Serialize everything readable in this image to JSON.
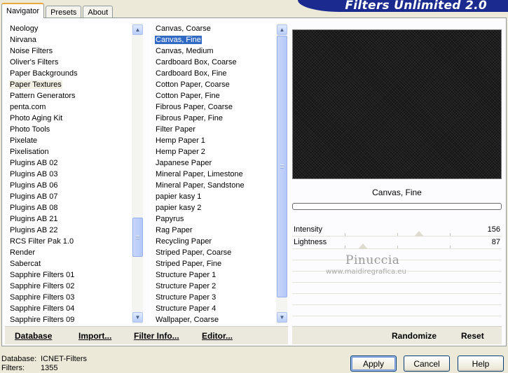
{
  "header": {
    "tabs": [
      {
        "label": "Navigator",
        "active": true
      },
      {
        "label": "Presets",
        "active": false
      },
      {
        "label": "About",
        "active": false
      }
    ],
    "banner_title": "Filters Unlimited 2.0"
  },
  "categories": {
    "items": [
      "Neology",
      "Nirvana",
      "Noise Filters",
      "Oliver's Filters",
      "Paper Backgrounds",
      "Paper Textures",
      "Pattern Generators",
      "penta.com",
      "Photo Aging Kit",
      "Photo Tools",
      "Pixelate",
      "Pixelisation",
      "Plugins AB 02",
      "Plugins AB 03",
      "Plugins AB 06",
      "Plugins AB 07",
      "Plugins AB 08",
      "Plugins AB 21",
      "Plugins AB 22",
      "RCS Filter Pak 1.0",
      "Render",
      "Sabercat",
      "Sapphire Filters 01",
      "Sapphire Filters 02",
      "Sapphire Filters 03",
      "Sapphire Filters 04",
      "Sapphire Filters 09"
    ],
    "selected": "Paper Textures"
  },
  "filters": {
    "items": [
      "Canvas, Coarse",
      "Canvas, Fine",
      "Canvas, Medium",
      "Cardboard Box, Coarse",
      "Cardboard Box, Fine",
      "Cotton Paper, Coarse",
      "Cotton Paper, Fine",
      "Fibrous Paper, Coarse",
      "Fibrous Paper, Fine",
      "Filter Paper",
      "Hemp Paper 1",
      "Hemp Paper 2",
      "Japanese Paper",
      "Mineral Paper, Limestone",
      "Mineral Paper, Sandstone",
      "papier kasy 1",
      "papier kasy 2",
      "Papyrus",
      "Rag Paper",
      "Recycling Paper",
      "Striped Paper, Coarse",
      "Striped Paper, Fine",
      "Structure Paper 1",
      "Structure Paper 2",
      "Structure Paper 3",
      "Structure Paper 4",
      "Wallpaper, Coarse"
    ],
    "selected": "Canvas, Fine"
  },
  "preview": {
    "filter_name": "Canvas, Fine",
    "params": [
      {
        "name": "Intensity",
        "value": "156"
      },
      {
        "name": "Lightness",
        "value": "87"
      }
    ]
  },
  "watermark": {
    "title": "Pinuccia",
    "url": "www.maidiregrafica.eu"
  },
  "toolbar_left": {
    "database": "Database",
    "import": "Import...",
    "filter_info": "Filter Info...",
    "editor": "Editor..."
  },
  "toolbar_right": {
    "randomize": "Randomize",
    "reset": "Reset"
  },
  "status": {
    "database_label": "Database:",
    "database_value": "ICNET-Filters",
    "filters_label": "Filters:",
    "filters_value": "1355"
  },
  "buttons": {
    "apply": "Apply",
    "cancel": "Cancel",
    "help": "Help"
  },
  "colors": {
    "selection": "#316ac5",
    "banner": "#1b2a8f",
    "dialog_bg": "#ece9d8"
  },
  "scroll": {
    "category_scroll_fraction": 0.66,
    "filter_scroll_fraction": 0.0
  }
}
